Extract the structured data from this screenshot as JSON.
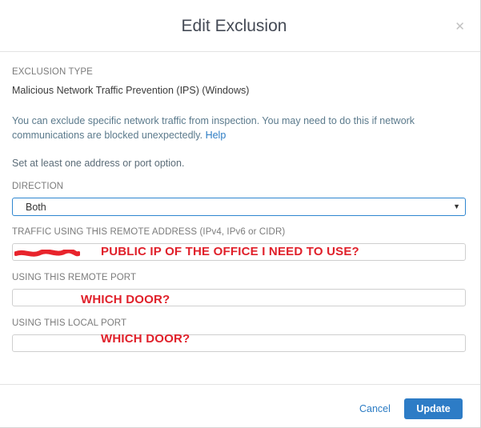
{
  "dialog": {
    "title": "Edit Exclusion",
    "close_glyph": "✕"
  },
  "exclusion_type": {
    "label": "EXCLUSION TYPE",
    "value": "Malicious Network Traffic Prevention (IPS) (Windows)"
  },
  "info": {
    "text": "You can exclude specific network traffic from inspection. You may need to do this if network communications are blocked unexpectedly.",
    "help_link": "Help"
  },
  "hint": "Set at least one address or port option.",
  "direction": {
    "label": "DIRECTION",
    "value": "Both",
    "caret": "▼"
  },
  "remote_address": {
    "label": "TRAFFIC USING THIS REMOTE ADDRESS (IPv4, IPv6 or CIDR)",
    "annotation": "PUBLIC IP OF THE OFFICE I NEED TO USE?"
  },
  "remote_port": {
    "label": "USING THIS REMOTE PORT",
    "annotation": "WHICH DOOR?"
  },
  "local_port": {
    "label": "USING THIS LOCAL PORT",
    "annotation": "WHICH DOOR?"
  },
  "footer": {
    "cancel_label": "Cancel",
    "update_label": "Update"
  },
  "colors": {
    "accent": "#2d7cc6",
    "annotation": "#e0202a",
    "redaction": "#e8242c"
  },
  "icons": {
    "close": "close-icon",
    "dropdown": "chevron-down-icon"
  }
}
